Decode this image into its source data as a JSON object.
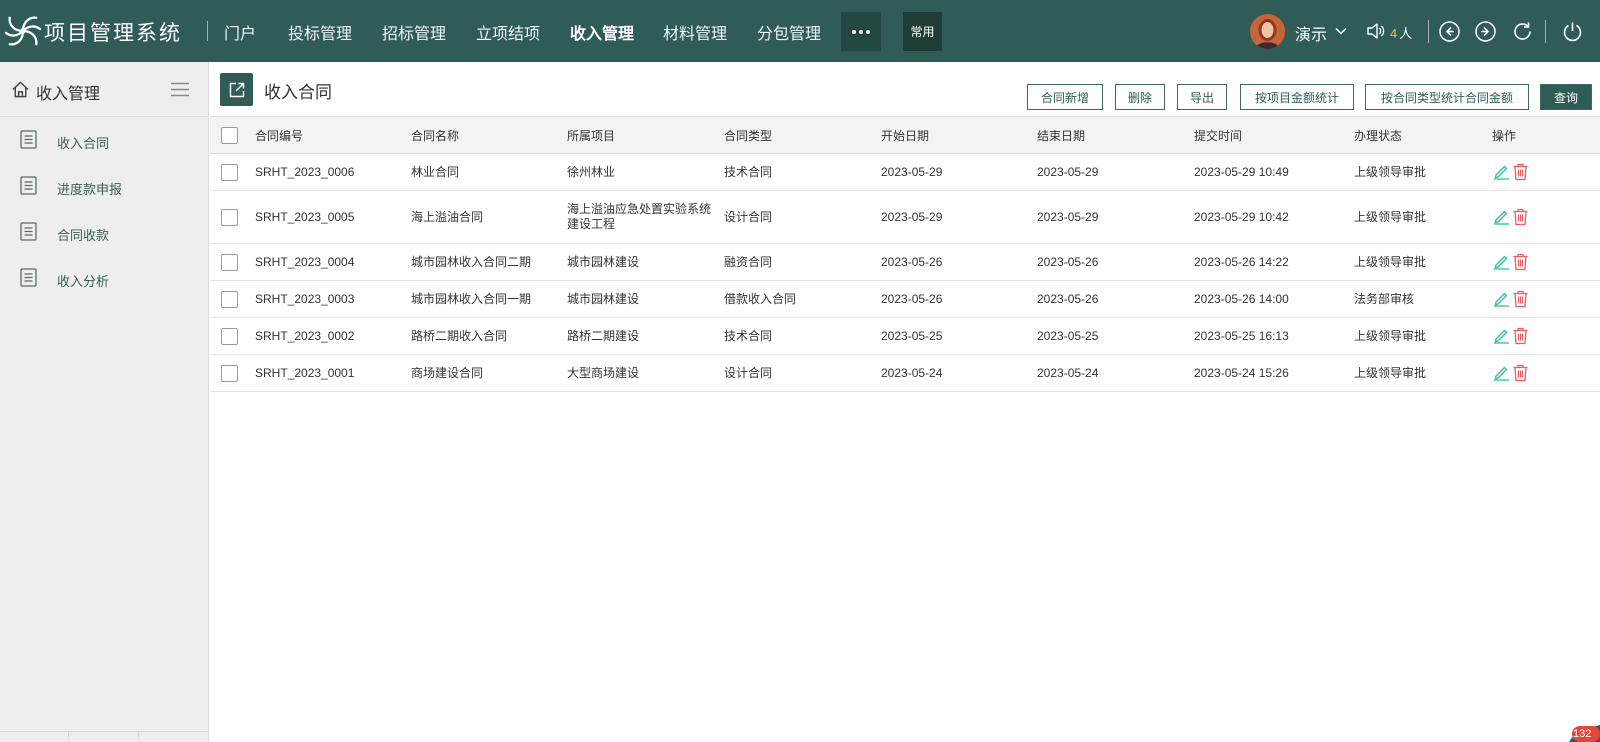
{
  "app": {
    "title": "项目管理系统"
  },
  "nav": {
    "items": [
      "门户",
      "投标管理",
      "招标管理",
      "立项结项",
      "收入管理",
      "材料管理",
      "分包管理"
    ],
    "active_index": 4,
    "common_label": "常用"
  },
  "user": {
    "name": "演示",
    "online_count": "4",
    "online_unit": "人"
  },
  "toolbar_icons": [
    "speaker-icon",
    "back-icon",
    "forward-icon",
    "refresh-icon",
    "power-icon"
  ],
  "sidebar": {
    "title": "收入管理",
    "items": [
      "收入合同",
      "进度款申报",
      "合同收款",
      "收入分析"
    ]
  },
  "page": {
    "title": "收入合同",
    "buttons": {
      "add": "合同新增",
      "delete": "删除",
      "export": "导出",
      "stat_project": "按项目金额统计",
      "stat_type": "按合同类型统计合同金额",
      "query": "查询"
    }
  },
  "table": {
    "columns": [
      "合同编号",
      "合同名称",
      "所属项目",
      "合同类型",
      "开始日期",
      "结束日期",
      "提交时间",
      "办理状态",
      "操作"
    ],
    "rows": [
      {
        "code": "SRHT_2023_0006",
        "name": "林业合同",
        "project": "徐州林业",
        "type": "技术合同",
        "start": "2023-05-29",
        "end": "2023-05-29",
        "submitted": "2023-05-29 10:49",
        "status": "上级领导审批"
      },
      {
        "code": "SRHT_2023_0005",
        "name": "海上溢油合同",
        "project": "海上溢油应急处置实验系统建设工程",
        "type": "设计合同",
        "start": "2023-05-29",
        "end": "2023-05-29",
        "submitted": "2023-05-29 10:42",
        "status": "上级领导审批"
      },
      {
        "code": "SRHT_2023_0004",
        "name": "城市园林收入合同二期",
        "project": "城市园林建设",
        "type": "融资合同",
        "start": "2023-05-26",
        "end": "2023-05-26",
        "submitted": "2023-05-26 14:22",
        "status": "上级领导审批"
      },
      {
        "code": "SRHT_2023_0003",
        "name": "城市园林收入合同一期",
        "project": "城市园林建设",
        "type": "借款收入合同",
        "start": "2023-05-26",
        "end": "2023-05-26",
        "submitted": "2023-05-26 14:00",
        "status": "法务部审核"
      },
      {
        "code": "SRHT_2023_0002",
        "name": "路桥二期收入合同",
        "project": "路桥二期建设",
        "type": "技术合同",
        "start": "2023-05-25",
        "end": "2023-05-25",
        "submitted": "2023-05-25 16:13",
        "status": "上级领导审批"
      },
      {
        "code": "SRHT_2023_0001",
        "name": "商场建设合同",
        "project": "大型商场建设",
        "type": "设计合同",
        "start": "2023-05-24",
        "end": "2023-05-24",
        "submitted": "2023-05-24 15:26",
        "status": "上级领导审批"
      }
    ]
  },
  "notification": {
    "count": "132"
  },
  "colors": {
    "topbar": "#2f5c57",
    "primary": "#2f5c57",
    "sidebar_bg": "#eeeeee",
    "edit_icon": "#2ebf9c",
    "delete_icon": "#f05c5c",
    "online_number": "#f0c23a",
    "badge": "#e6463a"
  }
}
